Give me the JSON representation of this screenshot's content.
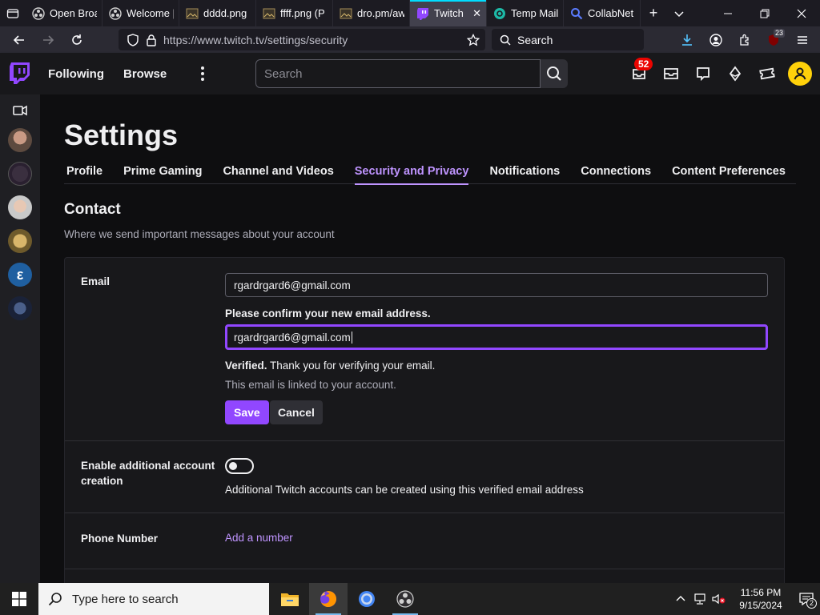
{
  "browser": {
    "tabs": [
      {
        "label": "Open Broa",
        "favicon": "obs-icon"
      },
      {
        "label": "Welcome |",
        "favicon": "obs-icon"
      },
      {
        "label": "dddd.png",
        "favicon": "image-icon"
      },
      {
        "label": "ffff.png (P",
        "favicon": "image-icon"
      },
      {
        "label": "dro.pm/aw",
        "favicon": "image-icon"
      },
      {
        "label": "Twitch",
        "favicon": "twitch-icon",
        "active": true
      },
      {
        "label": "Temp Mail",
        "favicon": "tempmail-icon"
      },
      {
        "label": "CollabNet",
        "favicon": "search-icon"
      }
    ],
    "url": "https://www.twitch.tv/settings/security",
    "search_placeholder": "Search",
    "extension_badge": "23"
  },
  "twitch": {
    "nav": {
      "following": "Following",
      "browse": "Browse"
    },
    "search_placeholder": "Search",
    "notification_count": "52",
    "accent": "#9147ff"
  },
  "settings": {
    "title": "Settings",
    "tabs": [
      "Profile",
      "Prime Gaming",
      "Channel and Videos",
      "Security and Privacy",
      "Notifications",
      "Connections",
      "Content Preferences"
    ],
    "active_tab": "Security and Privacy",
    "contact": {
      "title": "Contact",
      "subtitle": "Where we send important messages about your account"
    },
    "email": {
      "label": "Email",
      "value": "rgardrgard6@gmail.com",
      "confirm_label": "Please confirm your new email address.",
      "confirm_value": "rgardrgard6@gmail.com",
      "verified_bold": "Verified.",
      "verified_text": "Thank you for verifying your email.",
      "linked_text": "This email is linked to your account.",
      "save_label": "Save",
      "cancel_label": "Cancel"
    },
    "additional_accounts": {
      "label": "Enable additional account creation",
      "description": "Additional Twitch accounts can be created using this verified email address",
      "enabled": false
    },
    "phone": {
      "label": "Phone Number",
      "link": "Add a number"
    }
  },
  "taskbar": {
    "search_placeholder": "Type here to search",
    "time": "11:56 PM",
    "date": "9/15/2024",
    "notification_count": "2"
  }
}
